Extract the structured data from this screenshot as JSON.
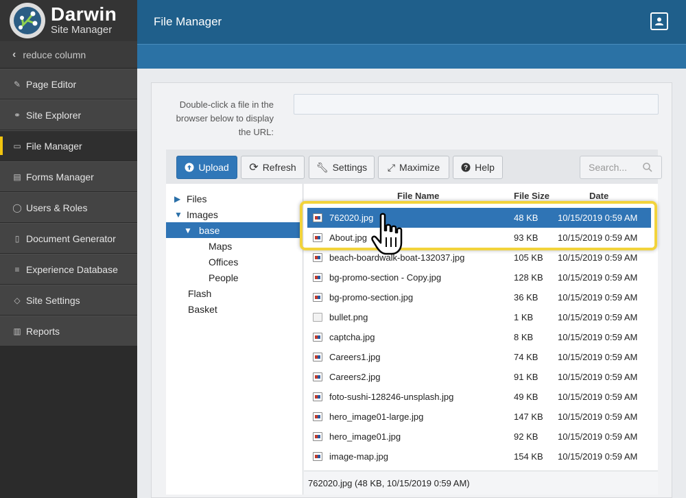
{
  "brand": {
    "title": "Darwin",
    "subtitle": "Site Manager"
  },
  "sidebar": {
    "reduce_label": "reduce column",
    "items": [
      {
        "label": "Page Editor",
        "icon": "edit-icon"
      },
      {
        "label": "Site Explorer",
        "icon": "binoculars-icon"
      },
      {
        "label": "File Manager",
        "icon": "folder-icon"
      },
      {
        "label": "Forms Manager",
        "icon": "form-icon"
      },
      {
        "label": "Users & Roles",
        "icon": "user-icon"
      },
      {
        "label": "Document Generator",
        "icon": "document-icon"
      },
      {
        "label": "Experience Database",
        "icon": "database-icon"
      },
      {
        "label": "Site Settings",
        "icon": "tag-icon"
      },
      {
        "label": "Reports",
        "icon": "chart-icon"
      }
    ],
    "active": "File Manager"
  },
  "header": {
    "title": "File Manager"
  },
  "url_hint": {
    "label": "Double-click a file in the browser below to display the URL:",
    "value": ""
  },
  "toolbar": {
    "upload": "Upload",
    "refresh": "Refresh",
    "settings": "Settings",
    "maximize": "Maximize",
    "help": "Help",
    "search_placeholder": "Search..."
  },
  "tree": {
    "files": "Files",
    "images": "Images",
    "base": "base",
    "maps": "Maps",
    "offices": "Offices",
    "people": "People",
    "flash": "Flash",
    "basket": "Basket"
  },
  "table": {
    "headers": {
      "name": "File Name",
      "size": "File Size",
      "date": "Date"
    },
    "rows": [
      {
        "name": "762020.jpg",
        "size": "48 KB",
        "date": "10/15/2019 0:59 AM"
      },
      {
        "name": "About.jpg",
        "size": "93 KB",
        "date": "10/15/2019 0:59 AM"
      },
      {
        "name": "beach-boardwalk-boat-132037.jpg",
        "size": "105 KB",
        "date": "10/15/2019 0:59 AM"
      },
      {
        "name": "bg-promo-section - Copy.jpg",
        "size": "128 KB",
        "date": "10/15/2019 0:59 AM"
      },
      {
        "name": "bg-promo-section.jpg",
        "size": "36 KB",
        "date": "10/15/2019 0:59 AM"
      },
      {
        "name": "bullet.png",
        "size": "1 KB",
        "date": "10/15/2019 0:59 AM"
      },
      {
        "name": "captcha.jpg",
        "size": "8 KB",
        "date": "10/15/2019 0:59 AM"
      },
      {
        "name": "Careers1.jpg",
        "size": "74 KB",
        "date": "10/15/2019 0:59 AM"
      },
      {
        "name": "Careers2.jpg",
        "size": "91 KB",
        "date": "10/15/2019 0:59 AM"
      },
      {
        "name": "foto-sushi-128246-unsplash.jpg",
        "size": "49 KB",
        "date": "10/15/2019 0:59 AM"
      },
      {
        "name": "hero_image01-large.jpg",
        "size": "147 KB",
        "date": "10/15/2019 0:59 AM"
      },
      {
        "name": "hero_image01.jpg",
        "size": "92 KB",
        "date": "10/15/2019 0:59 AM"
      },
      {
        "name": "image-map.jpg",
        "size": "154 KB",
        "date": "10/15/2019 0:59 AM"
      }
    ],
    "selected": "762020.jpg"
  },
  "status": "762020.jpg (48 KB, 10/15/2019 0:59 AM)",
  "colors": {
    "accent": "#2f74b5",
    "header": "#1f5f8b",
    "highlight": "#f2d33b",
    "sidebar": "#2b2b2b"
  }
}
